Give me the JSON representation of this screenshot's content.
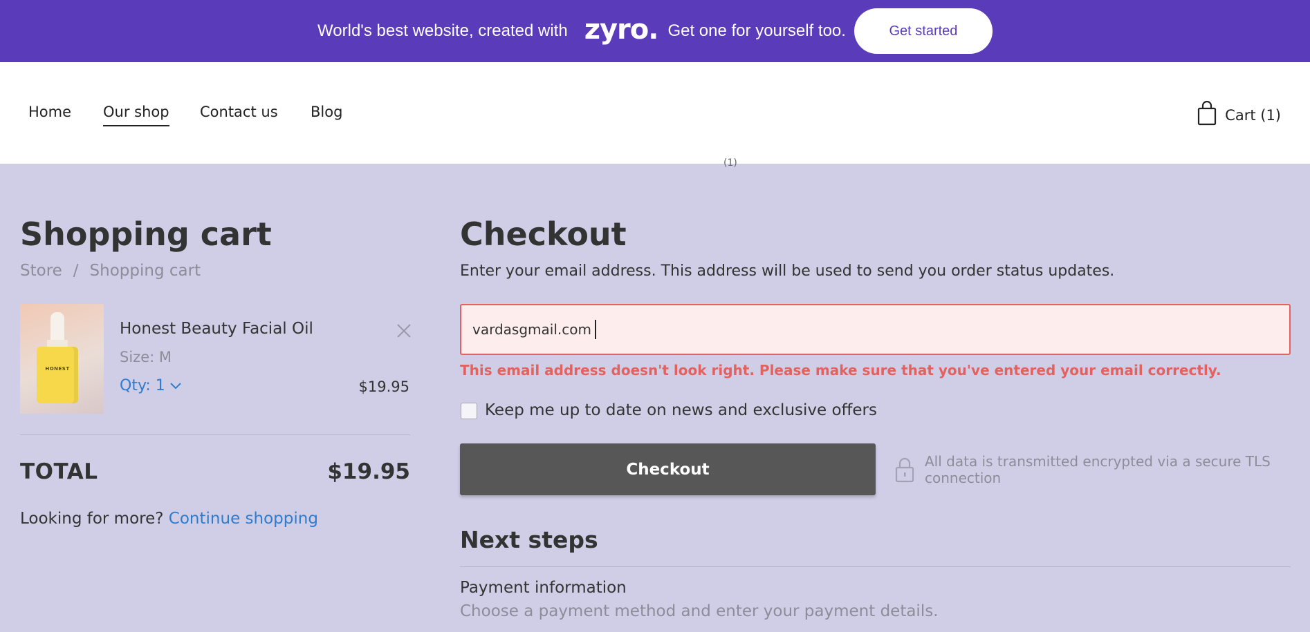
{
  "banner": {
    "text_left": "World's best website, created with",
    "logo": "zyro.",
    "text_right": "Get one for yourself too.",
    "cta_label": "Get started"
  },
  "nav": {
    "items": [
      {
        "label": "Home",
        "active": false
      },
      {
        "label": "Our shop",
        "active": true
      },
      {
        "label": "Contact us",
        "active": false
      },
      {
        "label": "Blog",
        "active": false
      }
    ],
    "cart_icon": "shopping-bag-icon",
    "cart_label": "Cart (1)",
    "page_index": "(1)"
  },
  "cart": {
    "title": "Shopping cart",
    "breadcrumb": [
      "Store",
      "/",
      "Shopping cart"
    ],
    "item": {
      "image_label": "HONEST",
      "name": "Honest Beauty Facial Oil",
      "size": "Size: M",
      "qty": "Qty: 1",
      "price": "$19.95"
    },
    "total_label": "TOTAL",
    "total_value": "$19.95",
    "more_prefix": "Looking for more?",
    "more_link": "Continue shopping"
  },
  "checkout": {
    "title": "Checkout",
    "instructions": "Enter your email address. This address will be used to send you order status updates.",
    "email_value": "vardasgmail.com",
    "error": "This email address doesn't look right. Please make sure that you've entered your email correctly.",
    "newsletter_label": "Keep me up to date on news and exclusive offers",
    "button_label": "Checkout",
    "secure_text": "All data is transmitted encrypted via a secure TLS connection",
    "next_steps_title": "Next steps",
    "step_title": "Payment information",
    "step_desc": "Choose a payment method and enter your payment details."
  },
  "colors": {
    "banner_bg": "#5a3bba",
    "page_bg": "#cfcee6",
    "error": "#e1625f",
    "link": "#2e7bcf",
    "button_bg": "#575757"
  }
}
